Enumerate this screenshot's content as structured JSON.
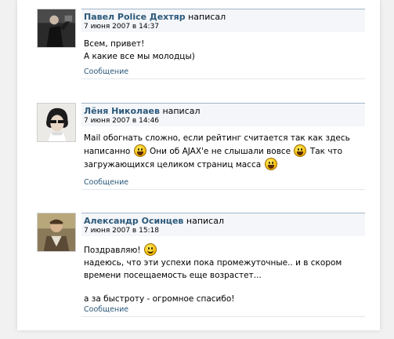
{
  "posts": [
    {
      "author": "Павел Police Дехтяр",
      "verb": "написал",
      "date": "7 июня 2007 в 14:37",
      "lines": [
        "Всем, привет!",
        "А какие все мы молодцы)"
      ],
      "link": "Сообщение"
    },
    {
      "author": "Лёня Николаев",
      "verb": "написал",
      "date": "7 июня 2007 в 14:46",
      "line1": "Mail обогнать сложно, если рейтинг считается так как здесь",
      "line2a": "написанно",
      "line2b": "Они об AJAX'е не слышали вовсе",
      "line2c": "Так что",
      "line3": "загружающихся целиком страниц масса",
      "link": "Сообщение"
    },
    {
      "author": "Александр Осинцев",
      "verb": "написал",
      "date": "7 июня 2007 в 15:18",
      "line1": "Поздравляю!",
      "line2": "надеюсь, что эти успехи пока промежуточные.. и в скором",
      "line3": "времени посещаемость еще возрастет...",
      "line4": "а за быстроту - огромное спасибо!",
      "link": "Сообщение"
    }
  ],
  "icons": [
    "smiley-grin-icon",
    "smiley-smile-icon"
  ],
  "colors": {
    "author": "#2b587a",
    "link": "#2b587a",
    "header_bg": "#f4f6f9",
    "header_border": "#a2b4c8"
  }
}
